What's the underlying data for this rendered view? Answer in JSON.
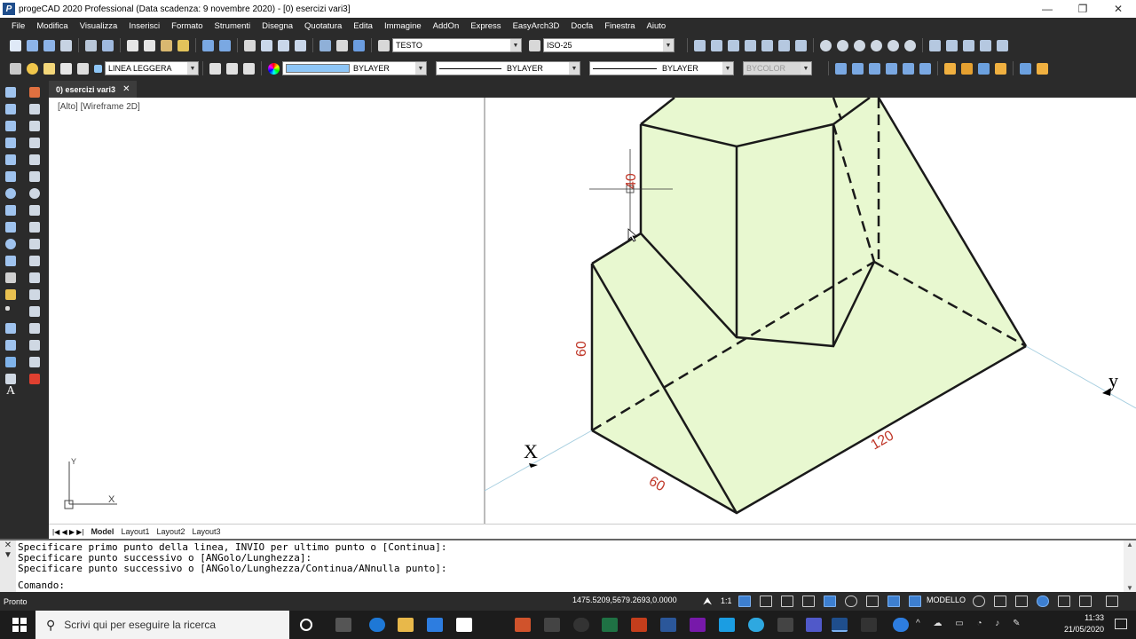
{
  "window": {
    "title": "progeCAD 2020 Professional  (Data scadenza: 9 novembre 2020) - [0) esercizi vari3]",
    "app_icon": "P",
    "minimize": "—",
    "maximize": "❐",
    "close": "✕"
  },
  "menu": [
    "File",
    "Modifica",
    "Visualizza",
    "Inserisci",
    "Formato",
    "Strumenti",
    "Disegna",
    "Quotatura",
    "Edita",
    "Immagine",
    "AddOn",
    "Express",
    "EasyArch3D",
    "Docfa",
    "Finestra",
    "Aiuto"
  ],
  "toolbar1": {
    "text_style": "TESTO",
    "dim_style": "ISO-25"
  },
  "toolbar2": {
    "layer": "LINEA LEGGERA",
    "color": "BYLAYER",
    "color_swatch": "#8ec6f7",
    "linetype": "BYLAYER",
    "lineweight": "BYLAYER",
    "plotstyle": "BYCOLOR"
  },
  "doc_tab": {
    "label": "0) esercizi vari3",
    "close": "✕"
  },
  "viewport": {
    "label": "[Alto] [Wireframe 2D]",
    "ucs_x": "X",
    "ucs_y": "Y"
  },
  "drawing": {
    "dim_40": "40",
    "dim_60_left": "60",
    "dim_60_bottom": "60",
    "dim_120": "120",
    "axis_x": "X",
    "axis_y": "y",
    "line_color": "#1a1a1a",
    "fill_color": "#e8f8d0",
    "dim_color": "#c0392b"
  },
  "layout_tabs": {
    "nav": "|◀ ◀ ▶ ▶|",
    "tabs": [
      "Model",
      "Layout1",
      "Layout2",
      "Layout3"
    ]
  },
  "command": {
    "line1": "Specificare primo punto della linea, INVIO per ultimo punto o [Continua]:",
    "line2": "Specificare punto successivo o [ANGolo/Lunghezza]:",
    "line3": "Specificare punto successivo o [ANGolo/Lunghezza/Continua/ANnulla punto]:",
    "prompt": "Comando:",
    "close": "✕",
    "expand": "▼"
  },
  "status": {
    "ready": "Pronto",
    "coords": "1475.5209,5679.2693,0.0000",
    "scale": "1:1",
    "space": "MODELLO"
  },
  "taskbar": {
    "search_placeholder": "Scrivi qui per eseguire la ricerca",
    "time": "11:33",
    "date": "21/05/2020"
  }
}
